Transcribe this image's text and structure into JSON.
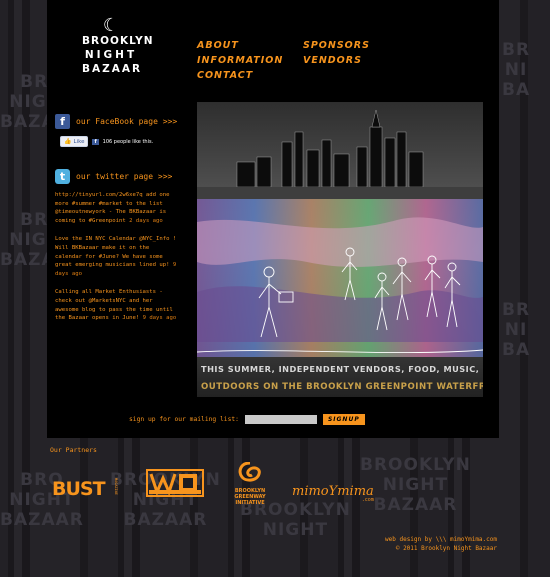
{
  "logo": {
    "line1": "BROOKLYN",
    "line2": "NIGHT",
    "line3": "BAZAAR"
  },
  "nav": {
    "col1": [
      "ABOUT",
      "INFORMATION",
      "CONTACT"
    ],
    "col2": [
      "SPONSORS",
      "VENDORS"
    ]
  },
  "facebook": {
    "link_label": "our FaceBook page >>>",
    "like_label": "Like",
    "like_count_text": "106 people like this."
  },
  "twitter": {
    "link_label": "our twitter page >>>",
    "tweets": [
      {
        "text": "http://tinyurl.com/2w6xe7q add one more #summer #market to the list @timeoutnewyork - The BKBazaar is coming to #Greenpoint",
        "time": "2 days ago"
      },
      {
        "text": "Love the IN NYC Calendar @NYC_Info ! Will BKBazaar make it on the calendar for #June? We have some great emerging musicians lined up!",
        "time": "9 days ago"
      },
      {
        "text": "Calling all Market Enthusiasts - check out @MarketsNYC and her awesome blog to pass the time until the Bazaar opens in June!",
        "time": "9 days ago"
      }
    ]
  },
  "hero": {
    "caption_line1": "THIS SUMMER, INDEPENDENT VENDORS, FOOD, MUSIC, BEER AND WINE,",
    "caption_line2": "OUTDOORS ON THE BROOKLYN GREENPOINT WATERFRONT"
  },
  "signup": {
    "label": "sign up for our mailing list:",
    "button_label": "SIGNUP",
    "input_value": ""
  },
  "partners": {
    "title": "Our Partners",
    "items": [
      {
        "name": "BUST",
        "sub": "MAGAZINE"
      },
      {
        "name": "WB",
        "sub": "BROOKLYN"
      },
      {
        "name": "BROOKLYN GREENWAY INITIATIVE"
      },
      {
        "name": "mimoYmima",
        "sub": ".com"
      }
    ]
  },
  "footer": {
    "credit": "web design by \\\\\\ mimoYmima.com",
    "copyright": "© 2011 Brooklyn Night Bazaar"
  },
  "colors": {
    "accent": "#f7941d",
    "page_bg": "#1d1b1f",
    "panel_bg": "#000000"
  }
}
